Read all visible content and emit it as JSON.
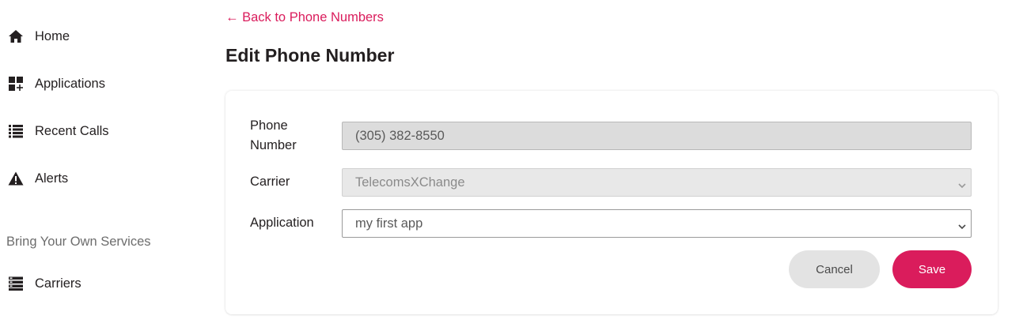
{
  "sidebar": {
    "items": [
      {
        "label": "Home",
        "icon": "home-icon"
      },
      {
        "label": "Applications",
        "icon": "applications-icon"
      },
      {
        "label": "Recent Calls",
        "icon": "list-icon"
      },
      {
        "label": "Alerts",
        "icon": "warning-icon"
      }
    ],
    "section_heading": "Bring Your Own Services",
    "byos_items": [
      {
        "label": "Carriers",
        "icon": "carriers-icon"
      }
    ]
  },
  "header": {
    "back_link": "← Back to Phone Numbers",
    "title": "Edit Phone Number"
  },
  "form": {
    "phone_label": "Phone Number",
    "phone_value": "(305) 382-8550",
    "carrier_label": "Carrier",
    "carrier_value": "TelecomsXChange",
    "application_label": "Application",
    "application_value": "my first app",
    "cancel_label": "Cancel",
    "save_label": "Save"
  },
  "colors": {
    "accent": "#da1c5c",
    "text": "#231f20",
    "muted": "#6d6d6d"
  }
}
